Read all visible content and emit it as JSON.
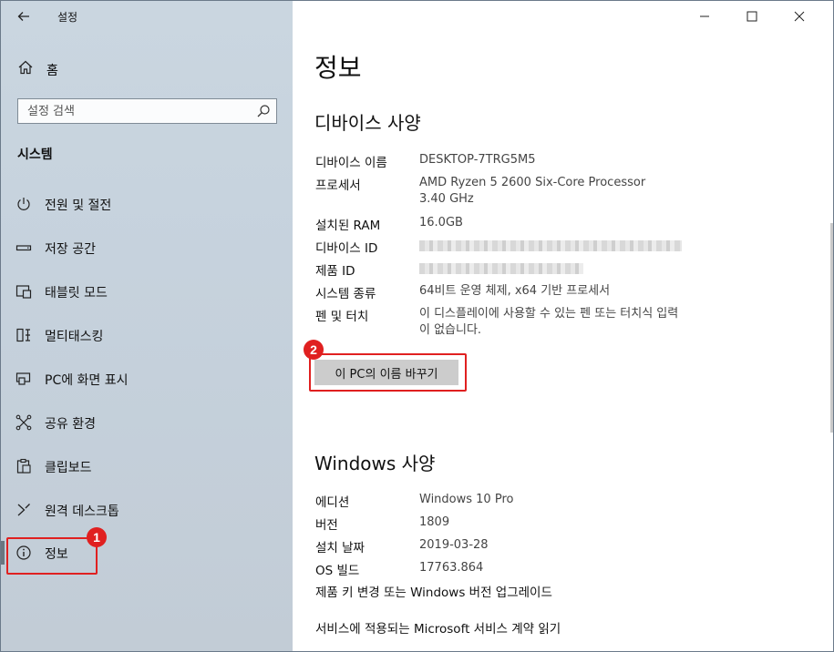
{
  "window": {
    "app_title": "설정",
    "back_icon": "arrow-left-icon",
    "controls": {
      "minimize": "—",
      "maximize": "☐",
      "close": "✕"
    }
  },
  "sidebar": {
    "home": {
      "label": "홈",
      "icon": "home-icon"
    },
    "search": {
      "placeholder": "설정 검색",
      "icon": "search-icon"
    },
    "section_title": "시스템",
    "items": [
      {
        "label": "전원 및 절전",
        "icon": "power-icon"
      },
      {
        "label": "저장 공간",
        "icon": "storage-icon"
      },
      {
        "label": "태블릿 모드",
        "icon": "tablet-icon"
      },
      {
        "label": "멀티태스킹",
        "icon": "multitasking-icon"
      },
      {
        "label": "PC에 화면 표시",
        "icon": "project-icon"
      },
      {
        "label": "공유 환경",
        "icon": "share-icon"
      },
      {
        "label": "클립보드",
        "icon": "clipboard-icon"
      },
      {
        "label": "원격 데스크톱",
        "icon": "remote-desktop-icon"
      },
      {
        "label": "정보",
        "icon": "info-icon",
        "selected": true
      }
    ]
  },
  "annotations": {
    "badge1": "1",
    "badge2": "2",
    "color": "#e02020"
  },
  "main": {
    "title": "정보",
    "device_specs": {
      "heading": "디바이스 사양",
      "rows": [
        {
          "key": "디바이스 이름",
          "value": "DESKTOP-7TRG5M5"
        },
        {
          "key": "프로세서",
          "value": "AMD Ryzen 5 2600 Six-Core Processor",
          "value2": "3.40 GHz"
        },
        {
          "key": "설치된 RAM",
          "value": "16.0GB"
        },
        {
          "key": "디바이스 ID",
          "value": ""
        },
        {
          "key": "제품 ID",
          "value": ""
        },
        {
          "key": "시스템 종류",
          "value": "64비트 운영 체제, x64 기반 프로세서"
        },
        {
          "key": "펜 및 터치",
          "value": "이 디스플레이에 사용할 수 있는 펜 또는 터치식 입력",
          "value2": "이 없습니다."
        }
      ],
      "rename_button": "이 PC의 이름 바꾸기"
    },
    "windows_specs": {
      "heading": "Windows 사양",
      "rows": [
        {
          "key": "에디션",
          "value": "Windows 10 Pro"
        },
        {
          "key": "버전",
          "value": "1809"
        },
        {
          "key": "설치 날짜",
          "value": "2019-03-28"
        },
        {
          "key": "OS 빌드",
          "value": "17763.864"
        }
      ],
      "link_product_key": "제품 키 변경 또는 Windows 버전 업그레이드",
      "link_service_agreement": "서비스에 적용되는 Microsoft 서비스 계약 읽기"
    }
  }
}
